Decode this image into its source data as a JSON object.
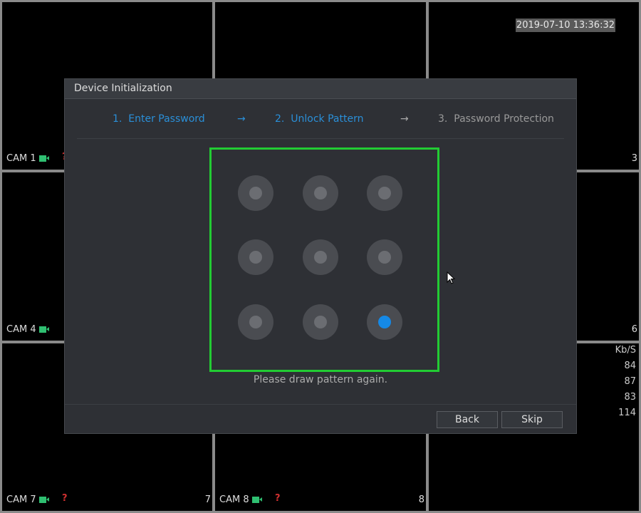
{
  "timestamp": "2019-07-10 13:36:32",
  "cameras": [
    {
      "label": "CAM 1"
    },
    {
      "label": "CAM 4"
    },
    {
      "label": "CAM 7"
    },
    {
      "label": "CAM 8"
    }
  ],
  "channel_numbers": [
    "3",
    "6",
    "7",
    "8"
  ],
  "bitrate": {
    "unit": "Kb/S",
    "values": [
      "84",
      "87",
      "83",
      "114"
    ]
  },
  "dialog": {
    "title": "Device Initialization",
    "steps": [
      {
        "label": "1.  Enter Password",
        "state": "done"
      },
      {
        "label": "2.  Unlock Pattern",
        "state": "active"
      },
      {
        "label": "3.  Password Protection",
        "state": "pending"
      }
    ],
    "arrow": "→",
    "pattern": {
      "selected": [
        9
      ],
      "count": 9
    },
    "message": "Please draw pattern again.",
    "back_label": "Back",
    "skip_label": "Skip"
  },
  "colors": {
    "accent": "#1589e6",
    "pattern_border": "#22cc33",
    "cam_icon": "#2fbf71",
    "alarm": "#d03030"
  }
}
